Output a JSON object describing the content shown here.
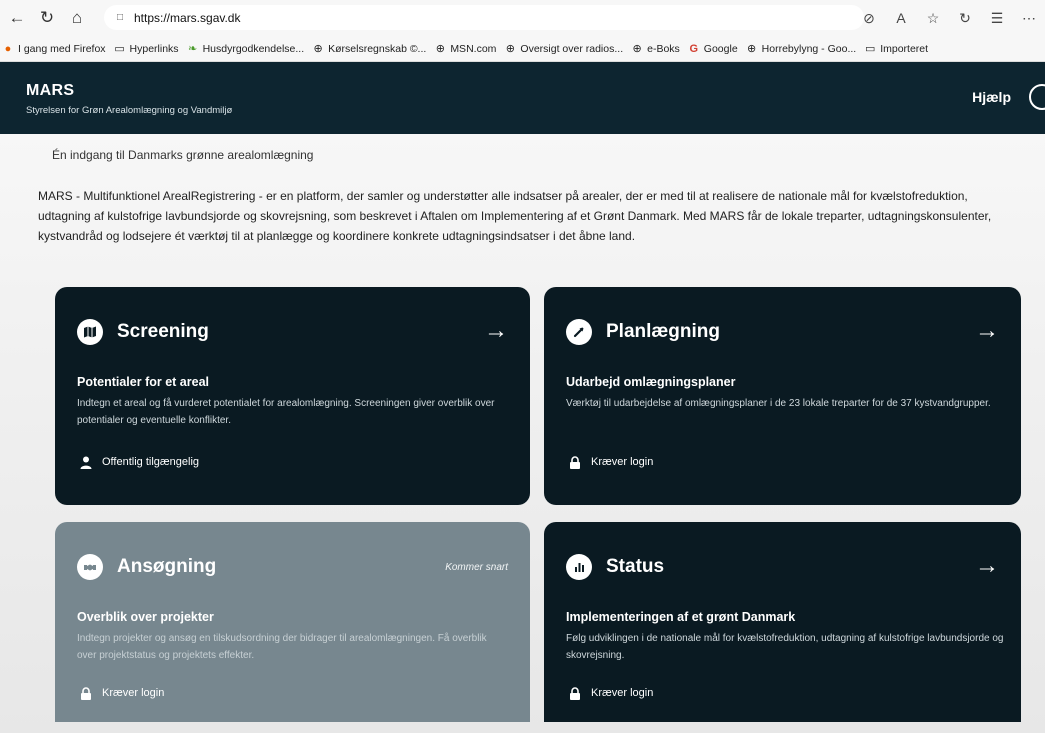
{
  "browser": {
    "url": "https://mars.sgav.dk",
    "bookmarks": [
      {
        "label": "I gang med Firefox",
        "icon": "firefox-icon"
      },
      {
        "label": "Hyperlinks",
        "icon": "folder-icon"
      },
      {
        "label": "Husdyrgodkendelse...",
        "icon": "leaf-icon"
      },
      {
        "label": "Kørselsregnskab ©...",
        "icon": "globe-icon"
      },
      {
        "label": "MSN.com",
        "icon": "globe-icon"
      },
      {
        "label": "Oversigt over radios...",
        "icon": "globe-icon"
      },
      {
        "label": "e-Boks",
        "icon": "globe-icon"
      },
      {
        "label": "Google",
        "icon": "google-icon"
      },
      {
        "label": "Horrebylyng - Goo...",
        "icon": "globe-icon"
      },
      {
        "label": "Importeret",
        "icon": "folder-icon"
      }
    ]
  },
  "header": {
    "title": "MARS",
    "subtitle": "Styrelsen for Grøn Arealomlægning og Vandmiljø",
    "help": "Hjælp"
  },
  "intro": {
    "tagline": "Én indgang til Danmarks grønne arealomlægning",
    "text": "MARS - Multifunktionel ArealRegistrering - er en platform, der samler og understøtter alle indsatser på arealer, der er med til at realisere de nationale mål for kvælstofreduktion, udtagning af kulstofrige lavbundsjorde og skovrejsning, som beskrevet i Aftalen om Implementering af et Grønt Danmark. Med MARS får de lokale treparter, udtagningskonsulenter, kystvandråd og lodsejere ét værktøj til at planlægge og koordinere konkrete udtagningsindsatser i det åbne land."
  },
  "cards": {
    "screening": {
      "title": "Screening",
      "subtitle": "Potentialer for et areal",
      "description": "Indtegn et areal og få vurderet potentialet for arealomlægning. Screeningen giver overblik over potentialer og eventuelle konflikter.",
      "access": "Offentlig tilgængelig"
    },
    "planning": {
      "title": "Planlægning",
      "subtitle": "Udarbejd omlægningsplaner",
      "description": "Værktøj til udarbejdelse af omlægningsplaner i de 23 lokale treparter for de 37 kystvandgrupper.",
      "access": "Kræver login"
    },
    "application": {
      "title": "Ansøgning",
      "badge": "Kommer snart",
      "subtitle": "Overblik over projekter",
      "description": "Indtegn projekter og ansøg en tilskudsordning der bidrager til arealomlægningen. Få overblik over projektstatus og projektets effekter.",
      "access": "Kræver login"
    },
    "status": {
      "title": "Status",
      "subtitle": "Implementeringen af et grønt Danmark",
      "description": "Følg udviklingen i de nationale mål for kvælstofreduktion, udtagning af kulstofrige lavbundsjorde og skovrejsning.",
      "access": "Kræver login"
    }
  },
  "colors": {
    "header_bg": "#0d2530",
    "card_dark": "#0a1a22",
    "card_disabled": "#77878f"
  }
}
